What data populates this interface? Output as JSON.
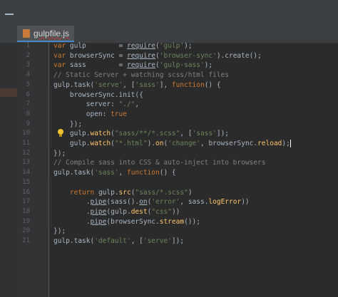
{
  "tab": {
    "file_name": "gulpfile.js"
  },
  "editor": {
    "lines": [
      {
        "n": "1",
        "tokens": [
          {
            "t": "var",
            "c": "kw"
          },
          {
            "t": " gulp        = "
          },
          {
            "t": "require",
            "c": "u"
          },
          {
            "t": "("
          },
          {
            "t": "'gulp'",
            "c": "str"
          },
          {
            "t": ");"
          }
        ]
      },
      {
        "n": "2",
        "tokens": [
          {
            "t": "var",
            "c": "kw"
          },
          {
            "t": " browserSync = "
          },
          {
            "t": "require",
            "c": "u"
          },
          {
            "t": "("
          },
          {
            "t": "'browser-sync'",
            "c": "str"
          },
          {
            "t": ").create();"
          }
        ]
      },
      {
        "n": "3",
        "tokens": [
          {
            "t": "var",
            "c": "kw"
          },
          {
            "t": " sass        = "
          },
          {
            "t": "require",
            "c": "u"
          },
          {
            "t": "("
          },
          {
            "t": "'gulp-sass'",
            "c": "str"
          },
          {
            "t": ");"
          }
        ]
      },
      {
        "n": "4",
        "tokens": [
          {
            "t": "// Static Server + watching scss/html files",
            "c": "cm"
          }
        ]
      },
      {
        "n": "5",
        "tokens": [
          {
            "t": "gulp.task("
          },
          {
            "t": "'serve'",
            "c": "str"
          },
          {
            "t": ", ["
          },
          {
            "t": "'sass'",
            "c": "str"
          },
          {
            "t": "], "
          },
          {
            "t": "function",
            "c": "kw"
          },
          {
            "t": "() {"
          }
        ]
      },
      {
        "n": "6",
        "tokens": [
          {
            "t": "    browserSync.init({"
          }
        ]
      },
      {
        "n": "7",
        "tokens": [
          {
            "t": "        server: "
          },
          {
            "t": "\"./\"",
            "c": "str"
          },
          {
            "t": ","
          }
        ]
      },
      {
        "n": "8",
        "tokens": [
          {
            "t": "        open: "
          },
          {
            "t": "true",
            "c": "kw"
          }
        ]
      },
      {
        "n": "9",
        "tokens": [
          {
            "t": "    });"
          }
        ]
      },
      {
        "n": "10",
        "tokens": [
          {
            "t": "    gulp."
          },
          {
            "t": "watch",
            "c": "fn"
          },
          {
            "t": "("
          },
          {
            "t": "\"sass/**/*.scss\"",
            "c": "str"
          },
          {
            "t": ", ["
          },
          {
            "t": "'sass'",
            "c": "str"
          },
          {
            "t": "]);"
          }
        ]
      },
      {
        "n": "11",
        "tokens": [
          {
            "t": "    gulp."
          },
          {
            "t": "watch",
            "c": "fn"
          },
          {
            "t": "("
          },
          {
            "t": "\"*.html\"",
            "c": "str"
          },
          {
            "t": ")."
          },
          {
            "t": "on",
            "c": "fn"
          },
          {
            "t": "("
          },
          {
            "t": "'change'",
            "c": "str"
          },
          {
            "t": ", browserSync."
          },
          {
            "t": "reload",
            "c": "fn"
          },
          {
            "t": ");"
          }
        ]
      },
      {
        "n": "12",
        "tokens": [
          {
            "t": "});"
          }
        ]
      },
      {
        "n": "13",
        "tokens": [
          {
            "t": "// Compile sass into CSS & auto-inject into browsers",
            "c": "cm"
          }
        ]
      },
      {
        "n": "14",
        "tokens": [
          {
            "t": "gulp.task("
          },
          {
            "t": "'sass'",
            "c": "str"
          },
          {
            "t": ", "
          },
          {
            "t": "function",
            "c": "kw"
          },
          {
            "t": "() {"
          }
        ]
      },
      {
        "n": "15",
        "tokens": [
          {
            "t": ""
          }
        ]
      },
      {
        "n": "16",
        "tokens": [
          {
            "t": "    "
          },
          {
            "t": "return",
            "c": "kw"
          },
          {
            "t": " gulp."
          },
          {
            "t": "src",
            "c": "fn"
          },
          {
            "t": "("
          },
          {
            "t": "\"sass/*.scss\"",
            "c": "str"
          },
          {
            "t": ")"
          }
        ]
      },
      {
        "n": "17",
        "tokens": [
          {
            "t": "        ."
          },
          {
            "t": "pipe",
            "c": "u"
          },
          {
            "t": "(sass()."
          },
          {
            "t": "on",
            "c": "u"
          },
          {
            "t": "("
          },
          {
            "t": "'error'",
            "c": "str"
          },
          {
            "t": ", sass."
          },
          {
            "t": "logError",
            "c": "fn"
          },
          {
            "t": "))"
          }
        ]
      },
      {
        "n": "18",
        "tokens": [
          {
            "t": "        ."
          },
          {
            "t": "pipe",
            "c": "u"
          },
          {
            "t": "(gulp."
          },
          {
            "t": "dest",
            "c": "fn"
          },
          {
            "t": "("
          },
          {
            "t": "\"css\"",
            "c": "str"
          },
          {
            "t": "))"
          }
        ]
      },
      {
        "n": "19",
        "tokens": [
          {
            "t": "        ."
          },
          {
            "t": "pipe",
            "c": "u"
          },
          {
            "t": "(browserSync."
          },
          {
            "t": "stream",
            "c": "fn"
          },
          {
            "t": "());"
          }
        ]
      },
      {
        "n": "20",
        "tokens": [
          {
            "t": "});"
          }
        ]
      },
      {
        "n": "21",
        "tokens": [
          {
            "t": "gulp.task("
          },
          {
            "t": "'default'",
            "c": "str"
          },
          {
            "t": ", ["
          },
          {
            "t": "'serve'",
            "c": "str"
          },
          {
            "t": "]);"
          }
        ]
      }
    ]
  },
  "colors": {
    "background": "#2b2b2b",
    "keyword": "#cc7832",
    "string": "#6a8759",
    "function": "#ffc66d",
    "comment": "#808080",
    "text": "#a9b7c6"
  },
  "icons": [
    "collapse-icon",
    "file-icon",
    "lightbulb-icon"
  ]
}
